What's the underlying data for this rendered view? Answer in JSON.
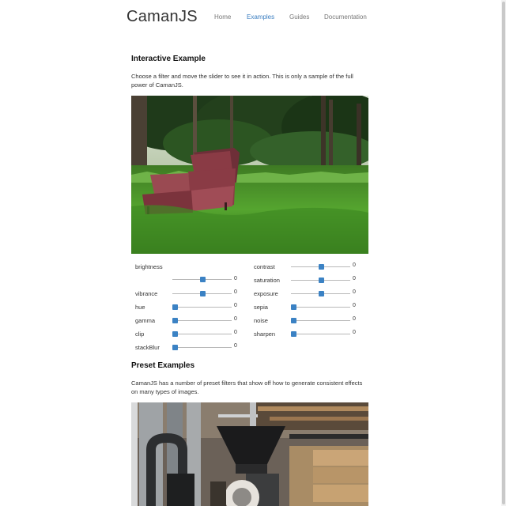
{
  "header": {
    "logo": "CamanJS",
    "nav": [
      "Home",
      "Examples",
      "Guides",
      "Documentation"
    ],
    "active": "Examples"
  },
  "interactive": {
    "title": "Interactive Example",
    "description": "Choose a filter and move the slider to see it in action. This is only a sample of the full power of CamanJS."
  },
  "controls": {
    "brightness": {
      "label": "brightness",
      "value": "0",
      "level": 0.5
    },
    "contrast": {
      "label": "contrast",
      "value": "0",
      "level": 0.5
    },
    "saturation": {
      "label": "saturation",
      "value": "0",
      "level": 0.5
    },
    "vibrance": {
      "label": "vibrance",
      "value": "0",
      "level": 0.5
    },
    "exposure": {
      "label": "exposure",
      "value": "0",
      "level": 0.5
    },
    "hue": {
      "label": "hue",
      "value": "0",
      "level": 0
    },
    "sepia": {
      "label": "sepia",
      "value": "0",
      "level": 0
    },
    "gamma": {
      "label": "gamma",
      "value": "0",
      "level": 0
    },
    "noise": {
      "label": "noise",
      "value": "0",
      "level": 0
    },
    "clip": {
      "label": "clip",
      "value": "0",
      "level": 0
    },
    "sharpen": {
      "label": "sharpen",
      "value": "0",
      "level": 0
    },
    "stackBlur": {
      "label": "stackBlur",
      "value": "0",
      "level": 0
    }
  },
  "unlabeled_slider": {
    "value": "0",
    "level": 0.5
  },
  "preset": {
    "title": "Preset Examples",
    "description": "CamanJS has a number of preset filters that show off how to generate consistent effects on many types of images."
  },
  "colors": {
    "accent": "#3b7ec1",
    "slider_handle": "#3b82c4",
    "grass": "#4f9a2a",
    "chair": "#8a3b45"
  }
}
